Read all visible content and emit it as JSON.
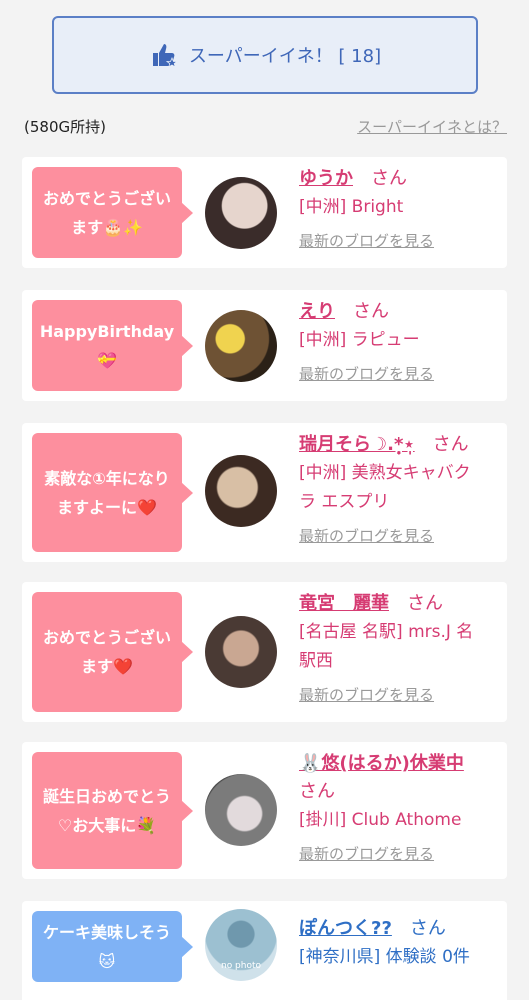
{
  "super_button": {
    "label": "スーパーイイネ！ [ 18]"
  },
  "owned": "(580G所持)",
  "what_link": "スーパーイイネとは？",
  "cards": [
    {
      "message_1": "おめでとうござい",
      "message_2": "ます🎂✨",
      "name": "ゆうか",
      "san": "さん",
      "shop_1": "[中洲] Bright",
      "shop_2": "",
      "blog": "最新のブログを見る",
      "avatar_colors": [
        "#d9c7bf",
        "#3a2c2a"
      ]
    },
    {
      "message_1": "HappyBirthday",
      "message_2": "💝",
      "name": "えり",
      "san": "さん",
      "shop_1": "[中洲] ラピュー",
      "shop_2": "",
      "blog": "最新のブログを見る",
      "avatar_colors": [
        "#5b4128",
        "#e8c64a"
      ]
    },
    {
      "message_1": "素敵な①年になり",
      "message_2": "ますよーに❤️",
      "name": "瑞月そら☽.*̣̩⋆̩",
      "san": "さん",
      "shop_1": "[中洲] 美熟女キャバク",
      "shop_2": "ラ エスプリ",
      "blog": "最新のブログを見る",
      "avatar_colors": [
        "#b79f86",
        "#3c2a22"
      ]
    },
    {
      "message_1": "おめでとうござい",
      "message_2": "ます❤️",
      "name": "竜宮　麗華",
      "san": "さん",
      "shop_1": "[名古屋 名駅] mrs.J 名",
      "shop_2": "駅西",
      "blog": "最新のブログを見る",
      "avatar_colors": [
        "#4a3a34",
        "#c9a792"
      ]
    },
    {
      "message_1": "誕生日おめでとう",
      "message_2": "♡お大事に💐",
      "name": "🐰悠(はるか)休業中",
      "san": "さん",
      "shop_1": "[掛川] Club Athome",
      "shop_2": "",
      "blog": "最新のブログを見る",
      "avatar_colors": [
        "#8a8a8a",
        "#d8d1d3"
      ]
    },
    {
      "message_1": "ケーキ美味しそう",
      "message_2": "🐱",
      "name": "ぽんつく??",
      "san": "さん",
      "shop_1": "[神奈川県] 体験談 0件",
      "shop_2": "",
      "blog": "",
      "avatar_colors": [
        "#8fb7c9",
        "#cfe1ea"
      ],
      "avatar_text": "no photo"
    }
  ],
  "colors": {
    "pink": "#fd8f9e",
    "blue_bubble": "#7fb2f5",
    "name_pink": "#d63c73",
    "name_blue": "#2f6fc5",
    "button_border": "#5b7fc6"
  }
}
